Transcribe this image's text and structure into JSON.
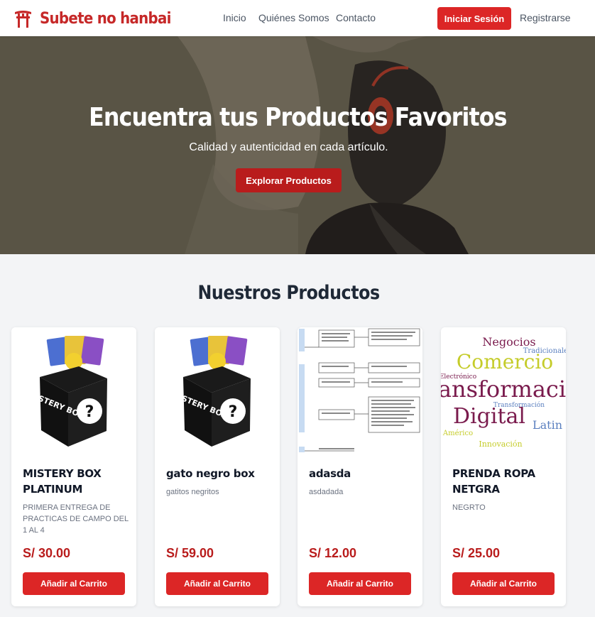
{
  "navbar": {
    "brand": "Subete no hanbai",
    "links": [
      "Inicio",
      "Quiénes Somos",
      "Contacto"
    ],
    "login": "Iniciar Sesión",
    "register": "Registrarse"
  },
  "hero": {
    "title": "Encuentra tus Productos Favoritos",
    "subtitle": "Calidad y autenticidad en cada artículo.",
    "cta": "Explorar Productos"
  },
  "products": {
    "title": "Nuestros Productos",
    "add_label": "Añadir al Carrito",
    "items": [
      {
        "name": "MISTERY BOX PLATINUM",
        "description": "PRIMERA ENTREGA DE PRACTICAS DE CAMPO DEL 1 AL 4",
        "price": "S/ 30.00",
        "image_text": "MYSTERY BOX"
      },
      {
        "name": "gato negro box",
        "description": "gatitos negritos",
        "price": "S/ 59.00",
        "image_text": "MYSTERY BOX"
      },
      {
        "name": "adasda",
        "description": "asdadada",
        "price": "S/ 12.00"
      },
      {
        "name": "PRENDA ROPA NETGRA",
        "description": "NEGRTO",
        "price": "S/ 25.00",
        "image_words": [
          "Comercio",
          "ansformaci",
          "Digital",
          "Negocios",
          "Latin",
          "Electrónico",
          "Innovación",
          "Transformación",
          "Tradicionales",
          "Américo"
        ]
      }
    ]
  },
  "colors": {
    "brand": "#c62828",
    "accent": "#dc2626",
    "price": "#b91c1c"
  }
}
